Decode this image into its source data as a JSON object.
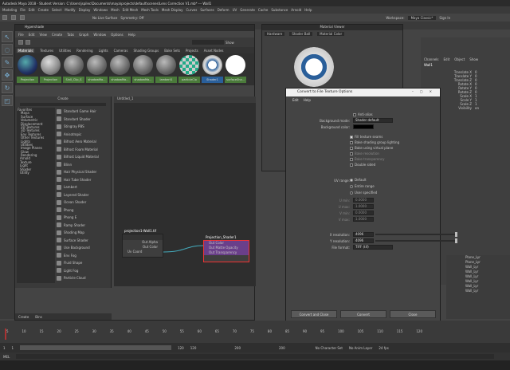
{
  "app_title": "Autodesk Maya 2018 - Student Version: C:\\Users\\jspilec\\Documents\\maya\\projects\\default\\scenes\\Lens Correction V1.mb* --- Wall1",
  "maya_menu": [
    "Modeling",
    "File",
    "Edit",
    "Create",
    "Select",
    "Modify",
    "Display",
    "Windows",
    "Mesh",
    "Edit Mesh",
    "Mesh Tools",
    "Mesh Display",
    "Curves",
    "Surfaces",
    "Deform",
    "UV",
    "Generate",
    "Cache",
    "Substance",
    "Arnold",
    "Help"
  ],
  "status": {
    "live_surface": "No Live Surface",
    "symmetry": "Symmetry: Off",
    "workspace_label": "Workspace:",
    "workspace": "Maya Classic*",
    "sign_in": "Sign In",
    "object_name": "Wall1"
  },
  "hypershade": {
    "title": "Hypershade",
    "menu": [
      "File",
      "Edit",
      "View",
      "Create",
      "Tabs",
      "Graph",
      "Window",
      "Options",
      "Help"
    ],
    "show_label": "Show",
    "tabs": [
      "Materials",
      "Textures",
      "Utilities",
      "Rendering",
      "Lights",
      "Cameras",
      "Shading Groups",
      "Bake Sets",
      "Projects",
      "Asset Nodes"
    ],
    "swatches": [
      "Projection",
      "Projection",
      "Sin0_Clip_S",
      "shadowMa...",
      "shadowMa...",
      "shadowMa...",
      "lambert1",
      "particleClo",
      "Shader1",
      "surfaceSha..."
    ],
    "create_title": "Create",
    "create_tree": [
      "Favorites",
      "Maya",
      "Surface",
      "Volumetric",
      "Displacement",
      "2D Textures",
      "3D Textures",
      "Env Textures",
      "Other Textures",
      "Lights",
      "Utilities",
      "Image Planes",
      "Glow",
      "Rendering",
      "Arnold",
      "Texture",
      "Light",
      "Shader",
      "Utility"
    ],
    "create_items": [
      "Standard Game Hair",
      "Standard Shader",
      "Stingray PBS",
      "Anisotropic",
      "Bifrost Aero Material",
      "Bifrost Foam Material",
      "Bifrost Liquid Material",
      "Blinn",
      "Hair Physical Shader",
      "Hair Tube Shader",
      "Lambert",
      "Layered Shader",
      "Ocean Shader",
      "Phong",
      "Phong E",
      "Ramp Shader",
      "Shading Map",
      "Surface Shader",
      "Use Background",
      "Env Fog",
      "Fluid Shape",
      "Light Fog",
      "Particle Cloud"
    ],
    "bottom_tabs": [
      "Create",
      "Bins"
    ],
    "node_editor_tab": "Untitled_1",
    "nodes": {
      "projection": {
        "title": "projection1-Wall1.tif",
        "ports": [
          "Out Alpha",
          "Out Color",
          "Uv Coord"
        ]
      },
      "shader": {
        "title": "Projection_Shader1",
        "ports": [
          "Out Color",
          "Out Matte Opacity",
          "Out Transparency"
        ]
      }
    }
  },
  "render_view": {
    "title": "Material Viewer",
    "renderer": "Hardware",
    "shape": "Shader Ball",
    "material": "Material Color"
  },
  "channel_box": {
    "tabs": [
      "Channels",
      "Edit",
      "Object",
      "Show"
    ],
    "object": "Wall1",
    "attrs": [
      {
        "n": "Translate X",
        "v": "0"
      },
      {
        "n": "Translate Y",
        "v": "0"
      },
      {
        "n": "Translate Z",
        "v": "0"
      },
      {
        "n": "Rotate X",
        "v": "0"
      },
      {
        "n": "Rotate Y",
        "v": "0"
      },
      {
        "n": "Rotate Z",
        "v": "0"
      },
      {
        "n": "Scale X",
        "v": "1"
      },
      {
        "n": "Scale Y",
        "v": "1"
      },
      {
        "n": "Scale Z",
        "v": "1"
      },
      {
        "n": "Visibility",
        "v": "on"
      }
    ]
  },
  "dialog": {
    "title": "Convert to File Texture Options",
    "menu": [
      "Edit",
      "Help"
    ],
    "anti_alias": "Anti-alias",
    "background_mode_label": "Background mode:",
    "background_mode": "Shader default",
    "background_color_label": "Background color:",
    "checks": [
      {
        "label": "Fill texture seams",
        "on": true
      },
      {
        "label": "Bake shading group lighting",
        "on": false
      },
      {
        "label": "Bake using virtual plane",
        "on": false
      },
      {
        "label": "Bake resolution",
        "on": false
      },
      {
        "label": "Bake transparency",
        "on": false
      },
      {
        "label": "Double sided",
        "on": false
      }
    ],
    "uv_range_label": "UV range:",
    "uv_options": [
      {
        "label": "Default",
        "on": true
      },
      {
        "label": "Entire range",
        "on": false
      },
      {
        "label": "User specified",
        "on": false
      }
    ],
    "uv_fields": [
      "U min:",
      "U max:",
      "V min:",
      "V max:"
    ],
    "uv_values": [
      "0.0000",
      "1.0000",
      "0.0000",
      "1.0000"
    ],
    "x_res_label": "X resolution:",
    "x_res": "4096",
    "y_res_label": "Y resolution:",
    "y_res": "4096",
    "format_label": "File format:",
    "format": "TIFF (tif)",
    "buttons": [
      "Convert and Close",
      "Convert",
      "Close"
    ]
  },
  "timeline": {
    "ticks": [
      "5",
      "10",
      "15",
      "20",
      "25",
      "30",
      "35",
      "40",
      "45",
      "50",
      "55",
      "60",
      "65",
      "70",
      "75",
      "80",
      "85",
      "90",
      "95",
      "100",
      "105",
      "110",
      "115",
      "120"
    ],
    "current": "1"
  },
  "range": {
    "start": "1",
    "start2": "1",
    "end": "120",
    "end2": "120",
    "anim_end": "200",
    "anim_end2": "200",
    "char_set": "No Character Set",
    "anim_layer": "No Anim Layer",
    "fps": "24 fps"
  },
  "mel_label": "MEL",
  "outliner_items": [
    "Plane_Lyr",
    "Plane_Lyr",
    "Wall_Lyr",
    "Wall_Lyr",
    "Wall_Lyr",
    "Wall_Lyr",
    "Wall_Lyr",
    "Wall_Lyr"
  ]
}
